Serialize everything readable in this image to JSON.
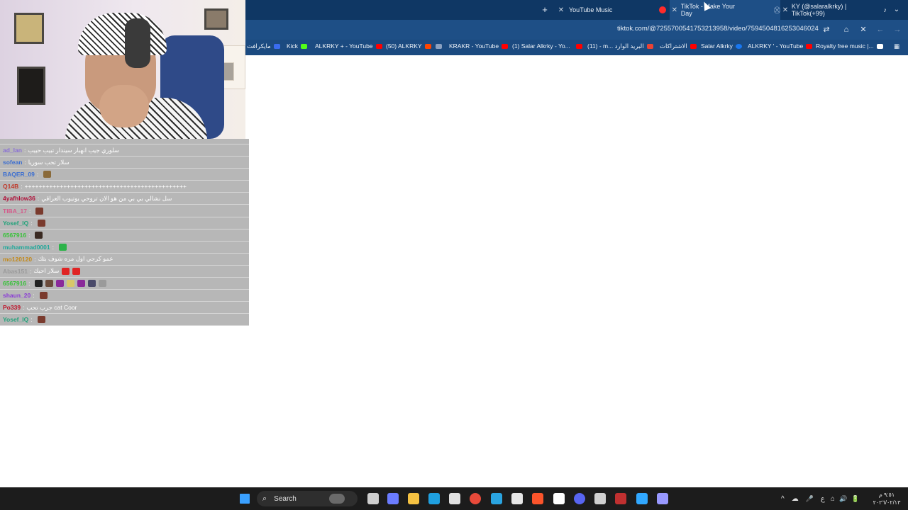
{
  "browser": {
    "tabs": [
      {
        "title": "YouTube Music",
        "active": false
      },
      {
        "title": "TikTok - Make Your Day",
        "active": true
      },
      {
        "title": "KY (@salaralkrky) | TikTok(+99)",
        "active": false
      }
    ],
    "new_tab_symbol": "+",
    "close_symbol": "✕",
    "url": "tiktok.com/@7255700541753213958/video/7594504816253046024",
    "bookmarks": [
      {
        "label": "مايكرافت",
        "color": "#3a6cf0"
      },
      {
        "label": "Kick",
        "color": "#53fc18"
      },
      {
        "label": "ALKRKY + - YouTube",
        "color": "#ff0000"
      },
      {
        "label": "(50) ALKRKY",
        "color": "#ff4500"
      },
      {
        "label": "KRAKR - YouTube",
        "color": "#ff0000"
      },
      {
        "label": "(1) Salar Alkrky - Yo...",
        "color": "#ff0000"
      },
      {
        "label": "(11) - m... البريد الوارد",
        "color": "#ea4335"
      },
      {
        "label": "الاشتراكات",
        "color": "#ff0000"
      },
      {
        "label": "Salar Alkrky",
        "color": "#1877f2"
      },
      {
        "label": "ALKRKY ' - YouTube",
        "color": "#ff0000"
      },
      {
        "label": "Royalty free music |...",
        "color": "#ffffff"
      }
    ]
  },
  "chat": {
    "messages": [
      {
        "user": "ad_lan",
        "user_color": "#8a6fd6",
        "text": "سلوري جيب انهبار سيندار تبيب حبيب",
        "emotes": []
      },
      {
        "user": "sofean",
        "user_color": "#3d6fd0",
        "text": "سلار تحب سوريا",
        "emotes": []
      },
      {
        "user": "BAQER_09",
        "user_color": "#3d6fd0",
        "text": "",
        "emotes": [
          "#8a6a3a"
        ]
      },
      {
        "user": "Q14B",
        "user_color": "#c0392b",
        "text": "++++++++++++++++++++++++++++++++++++++++++++++",
        "emotes": []
      },
      {
        "user": "4yafhlow36",
        "user_color": "#b0123a",
        "text": "سل نشالي بي بي من هو الان تروحي يوتيوب العراقي",
        "emotes": []
      },
      {
        "user": "TIBA_17",
        "user_color": "#d45a8a",
        "text": "",
        "emotes": [
          "#7a3b2e"
        ]
      },
      {
        "user": "Yosef_IQ",
        "user_color": "#22a27a",
        "text": "",
        "emotes": [
          "#7a3b2e"
        ]
      },
      {
        "user": "6567916",
        "user_color": "#39c23a",
        "text": "",
        "emotes": [
          "#3a2a22"
        ]
      },
      {
        "user": "muhammad0001",
        "user_color": "#1fa89a",
        "text": "",
        "emotes": [
          "#2db34a"
        ]
      },
      {
        "user": "mo120120",
        "user_color": "#c48a1a",
        "text": "عمو كرجي اول مره شوف بثك",
        "emotes": []
      },
      {
        "user": "Abas151",
        "user_color": "#9a9a9a",
        "text": "سلار احبك",
        "emotes": [
          "#e02424",
          "#e02424"
        ]
      },
      {
        "user": "6567916",
        "user_color": "#39c23a",
        "text": "",
        "emotes": [
          "#222222",
          "#6a4a3a",
          "#8a2a9a",
          "#d8c86a",
          "#8a2a9a",
          "#4a4a6a",
          "#9a9a9a"
        ]
      },
      {
        "user": "shaun_20",
        "user_color": "#8a3ad6",
        "text": "",
        "emotes": [
          "#7a3b2e"
        ]
      },
      {
        "user": "Po339",
        "user_color": "#c0132a",
        "text": "جرب تحب cat Coor",
        "emotes": []
      },
      {
        "user": "Yosef_IQ",
        "user_color": "#22a27a",
        "text": "",
        "emotes": [
          "#7a3b2e"
        ]
      }
    ]
  },
  "taskbar": {
    "search_label": "Search",
    "icons": [
      {
        "name": "windows-start-icon",
        "color": "#3aa0ff"
      },
      {
        "name": "task-view-icon",
        "color": "#cfcfcf"
      },
      {
        "name": "copilot-icon",
        "color": "#6b7cff"
      },
      {
        "name": "file-explorer-icon",
        "color": "#f5c242"
      },
      {
        "name": "edge-icon",
        "color": "#1fa0e0"
      },
      {
        "name": "store-icon",
        "color": "#e0e0e0"
      },
      {
        "name": "chrome-icon",
        "color": "#e84a3a"
      },
      {
        "name": "telegram-icon",
        "color": "#2aa4e0"
      },
      {
        "name": "obs-icon",
        "color": "#e6e6e6"
      },
      {
        "name": "brave-icon",
        "color": "#fb542b"
      },
      {
        "name": "capcut-icon",
        "color": "#ffffff"
      },
      {
        "name": "discord-icon",
        "color": "#5865f2"
      },
      {
        "name": "settings-icon",
        "color": "#d0d0d0"
      },
      {
        "name": "app-icon",
        "color": "#c03030"
      },
      {
        "name": "photoshop-icon",
        "color": "#31a8ff"
      },
      {
        "name": "premiere-icon",
        "color": "#9999ff"
      }
    ],
    "tray": [
      "^",
      "☁",
      "🎤",
      "ع",
      "⌂",
      "🔊",
      "🔋"
    ],
    "clock_time": "٩:٥١ م",
    "clock_date": "٢٠٢٦/٠٢/١٣"
  }
}
